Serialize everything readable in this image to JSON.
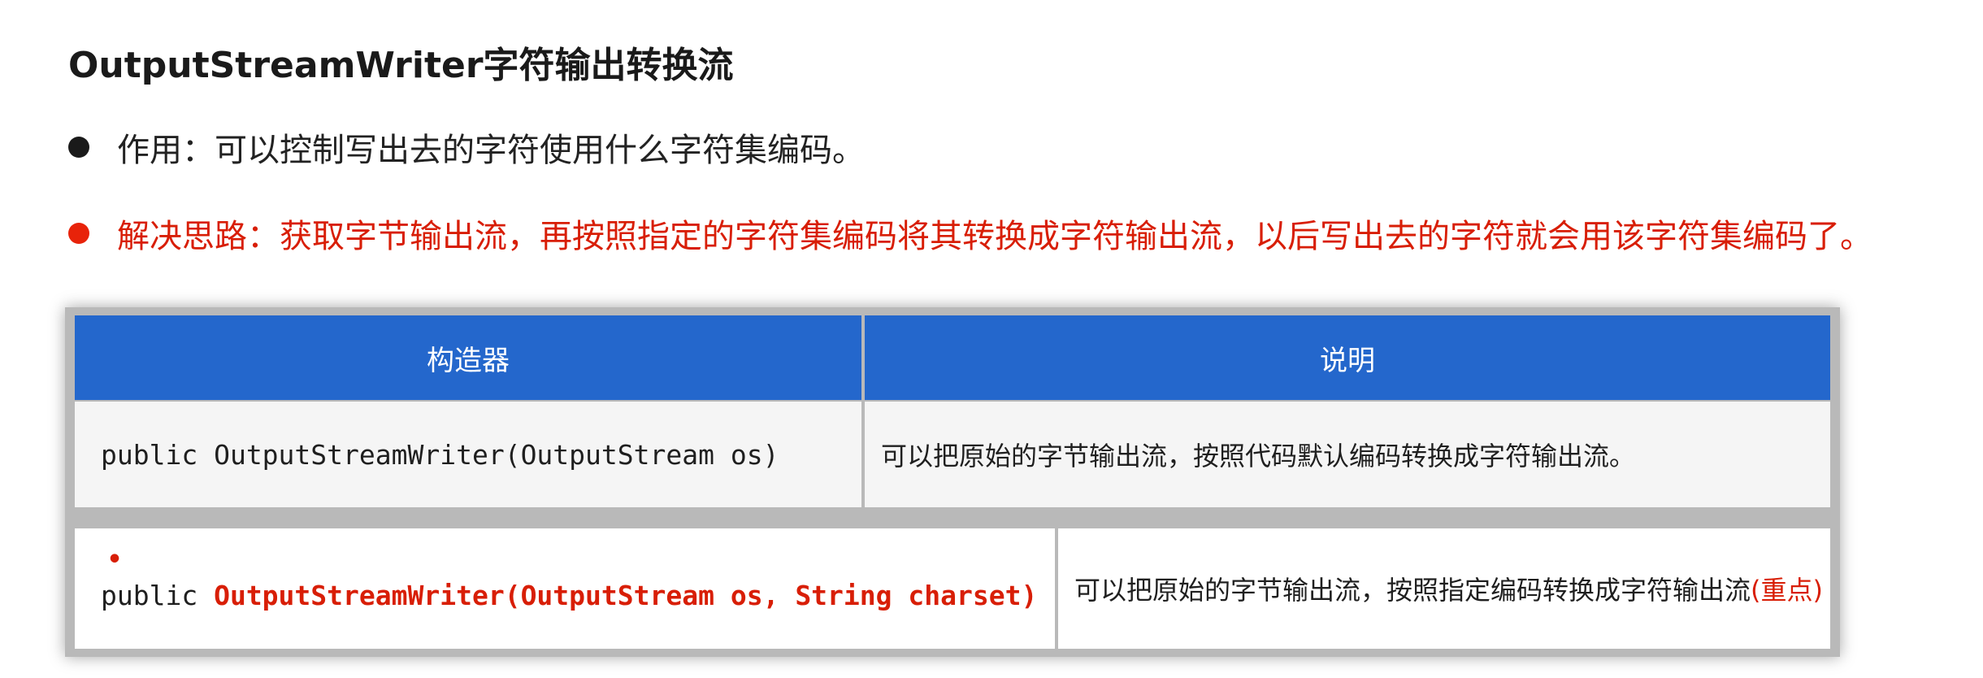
{
  "title": "OutputStreamWriter字符输出转换流",
  "bullets": [
    {
      "text": "作用：可以控制写出去的字符使用什么字符集编码。",
      "color": "#222222"
    },
    {
      "text": "解决思路：获取字节输出流，再按照指定的字符集编码将其转换成字符输出流，以后写出去的字符就会用该字符集编码了。",
      "color": "#d81e06"
    }
  ],
  "table": {
    "headers": [
      "构造器",
      "说明"
    ],
    "rows": [
      {
        "constructor_prefix": "public ",
        "constructor_sig": "OutputStreamWriter(OutputStream os)",
        "description": "可以把原始的字节输出流，按照代码默认编码转换成字符输出流。",
        "description_note": ""
      },
      {
        "marker": "•",
        "constructor_prefix": "public ",
        "constructor_sig": "OutputStreamWriter(OutputStream os, String charset)",
        "description": "可以把原始的字节输出流，按照指定编码转换成字符输出流",
        "description_note": "(重点)"
      }
    ]
  },
  "colors": {
    "header_bg": "#2467cc",
    "accent_red": "#d81e06"
  }
}
